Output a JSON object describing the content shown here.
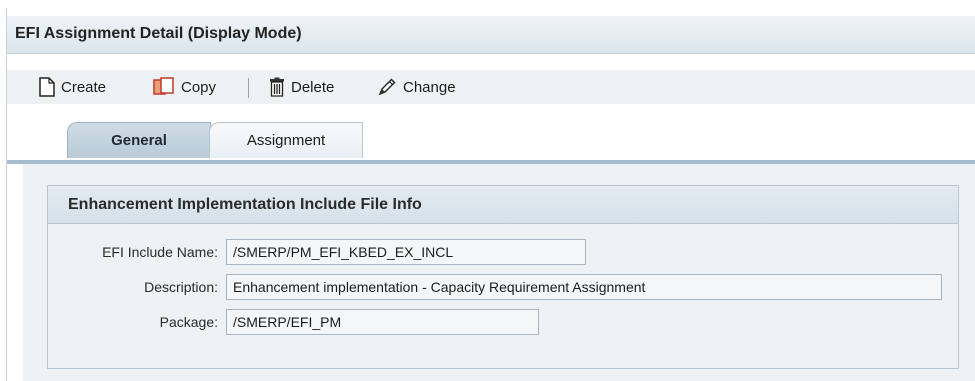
{
  "window": {
    "title": "EFI Assignment Detail (Display Mode)"
  },
  "toolbar": {
    "create_label": "Create",
    "copy_label": "Copy",
    "delete_label": "Delete",
    "change_label": "Change"
  },
  "tabs": [
    {
      "label": "General",
      "active": true
    },
    {
      "label": "Assignment",
      "active": false
    }
  ],
  "group": {
    "title": "Enhancement Implementation Include File Info",
    "fields": {
      "include_name": {
        "label": "EFI Include Name:",
        "value": "/SMERP/PM_EFI_KBED_EX_INCL"
      },
      "description": {
        "label": "Description:",
        "value": "Enhancement implementation - Capacity Requirement Assignment"
      },
      "package": {
        "label": "Package:",
        "value": "/SMERP/EFI_PM"
      }
    }
  }
}
